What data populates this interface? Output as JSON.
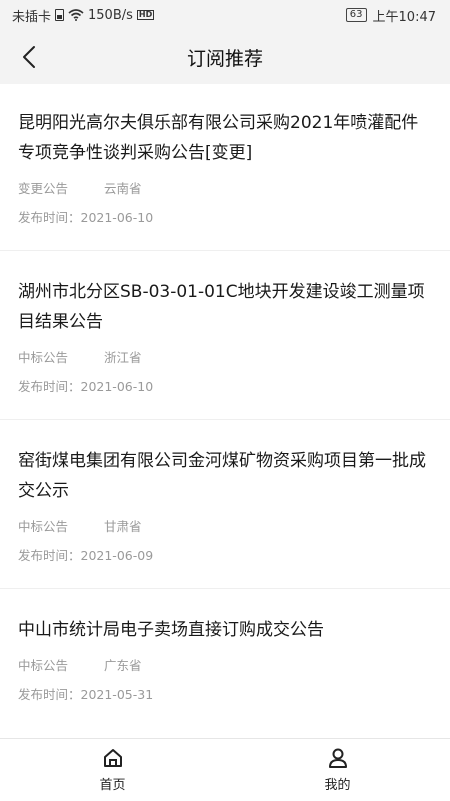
{
  "status_bar": {
    "carrier": "未插卡",
    "speed": "150B/s",
    "network_badge": "HD",
    "battery": "63",
    "time": "上午10:47"
  },
  "header": {
    "title": "订阅推荐"
  },
  "items": [
    {
      "title": "昆明阳光高尔夫俱乐部有限公司采购2021年喷灌配件专项竞争性谈判采购公告[变更]",
      "type": "变更公告",
      "region": "云南省",
      "date": "发布时间：2021-06-10"
    },
    {
      "title": "湖州市北分区SB-03-01-01C地块开发建设竣工测量项目结果公告",
      "type": "中标公告",
      "region": "浙江省",
      "date": "发布时间：2021-06-10"
    },
    {
      "title": "窑街煤电集团有限公司金河煤矿物资采购项目第一批成交公示",
      "type": "中标公告",
      "region": "甘肃省",
      "date": "发布时间：2021-06-09"
    },
    {
      "title": "中山市统计局电子卖场直接订购成交公告",
      "type": "中标公告",
      "region": "广东省",
      "date": "发布时间：2021-05-31"
    }
  ],
  "tabbar": {
    "home_label": "首页",
    "mine_label": "我的"
  }
}
